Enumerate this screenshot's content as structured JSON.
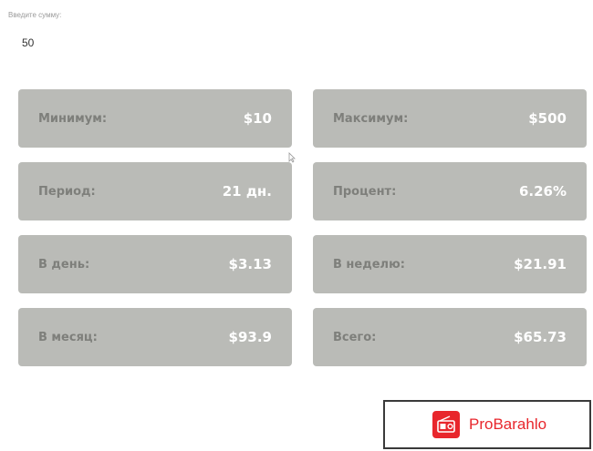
{
  "form": {
    "amount_label": "Введите сумму:",
    "amount_value": "50"
  },
  "cards": [
    {
      "label": "Минимум:",
      "value": "$10"
    },
    {
      "label": "Максимум:",
      "value": "$500"
    },
    {
      "label": "Период:",
      "value": "21 дн."
    },
    {
      "label": "Процент:",
      "value": "6.26%"
    },
    {
      "label": "В день:",
      "value": "$3.13"
    },
    {
      "label": "В неделю:",
      "value": "$21.91"
    },
    {
      "label": "В месяц:",
      "value": "$93.9"
    },
    {
      "label": "Всего:",
      "value": "$65.73"
    }
  ],
  "watermark": {
    "text": "ProBarahlo",
    "icon": "radio-icon"
  },
  "colors": {
    "card_bg": "#babbb7",
    "card_label": "#7e7f7b",
    "card_value": "#ffffff",
    "brand_red": "#e8262c"
  }
}
